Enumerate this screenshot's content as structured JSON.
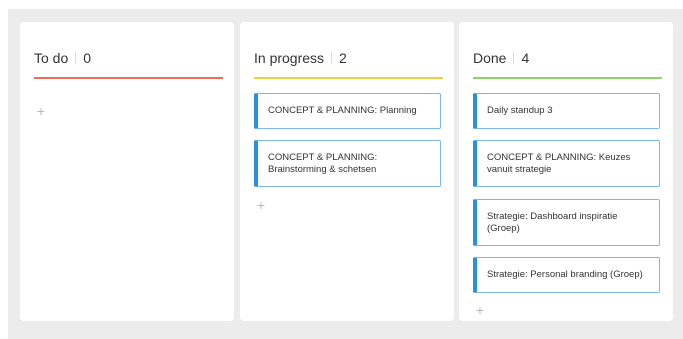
{
  "columns": [
    {
      "title": "To do",
      "count": "0",
      "accent": "#f06a55",
      "cards": []
    },
    {
      "title": "In progress",
      "count": "2",
      "accent": "#f2cc42",
      "cards": [
        {
          "text": "CONCEPT & PLANNING: Planning"
        },
        {
          "text": "CONCEPT & PLANNING: Brainstorming & schetsen"
        }
      ]
    },
    {
      "title": "Done",
      "count": "4",
      "accent": "#8fd26a",
      "cards": [
        {
          "text": "Daily standup 3"
        },
        {
          "text": "CONCEPT & PLANNING: Keuzes vanuit strategie"
        },
        {
          "text": "Strategie: Dashboard inspiratie (Groep)"
        },
        {
          "text": "Strategie: Personal branding (Groep)"
        }
      ]
    }
  ],
  "add_symbol": "+",
  "colors": {
    "card_border": "#7fb8e6",
    "card_accent": "#2b8fde",
    "board_background": "#ececec"
  }
}
